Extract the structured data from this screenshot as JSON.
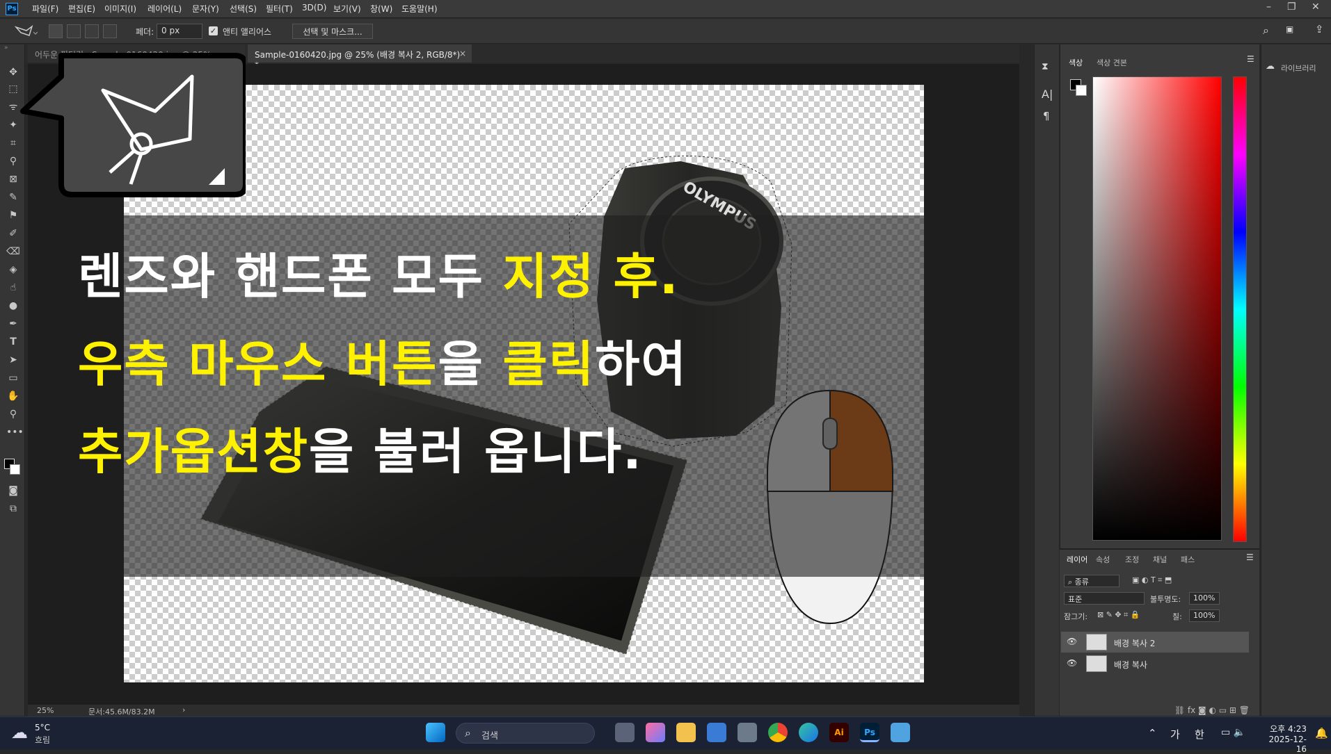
{
  "menubar": {
    "items": [
      "파일(F)",
      "편집(E)",
      "이미지(I)",
      "레이어(L)",
      "문자(Y)",
      "선택(S)",
      "필터(T)",
      "3D(D)",
      "보기(V)",
      "창(W)",
      "도움말(H)"
    ],
    "logo": "Ps"
  },
  "options": {
    "feather_label": "페더:",
    "feather_value": "0 px",
    "antialias_label": "앤티 앨리어스",
    "antialias_checked": true,
    "select_mask_label": "선택 및 마스크..."
  },
  "tabs": [
    {
      "label": "어두운 필터링 - Sample-0160420.jpg @ 25%",
      "active": false
    },
    {
      "label": "Sample-0160420.jpg @ 25% (배경 복사 2, RGB/8*) *",
      "active": true
    }
  ],
  "status": {
    "zoom": "25%",
    "doc": "문서:45.6M/83.2M"
  },
  "caption": {
    "line1": [
      {
        "text": "렌즈와 핸드폰 모두 ",
        "color": "white"
      },
      {
        "text": "지정 후.",
        "color": "yellow"
      }
    ],
    "line2": [
      {
        "text": "우측 마우스 버튼",
        "color": "yellow"
      },
      {
        "text": "을 ",
        "color": "white"
      },
      {
        "text": "클릭",
        "color": "yellow"
      },
      {
        "text": "하여",
        "color": "white"
      }
    ],
    "line3": [
      {
        "text": "추가옵션창",
        "color": "yellow"
      },
      {
        "text": "을 불러 옵니다.",
        "color": "white"
      }
    ]
  },
  "lens_brand": "OLYMPUS",
  "color_panel": {
    "tabs": [
      "색상",
      "색상 견본"
    ]
  },
  "layers_panel": {
    "tabs": [
      "레이어",
      "속성",
      "조정",
      "채널",
      "패스"
    ],
    "filter": "종류",
    "blend_mode": "표준",
    "opacity_label": "불투명도:",
    "opacity": "100%",
    "lock_label": "잠그기:",
    "fill_label": "칠:",
    "fill": "100%",
    "layers": [
      {
        "name": "배경 복사 2",
        "selected": true
      },
      {
        "name": "배경 복사",
        "selected": false
      }
    ]
  },
  "library": {
    "label": "라이브러리"
  },
  "taskbar": {
    "weather_temp": "5°C",
    "weather_desc": "흐림",
    "search_placeholder": "검색",
    "ime_1": "가",
    "ime_2": "한",
    "time": "오후 4:23",
    "date": "2025-12-16"
  },
  "colors": {
    "caption_yellow": "#fff200",
    "mouse_orange": "#e8660a",
    "ps_blue": "#31a8ff"
  }
}
